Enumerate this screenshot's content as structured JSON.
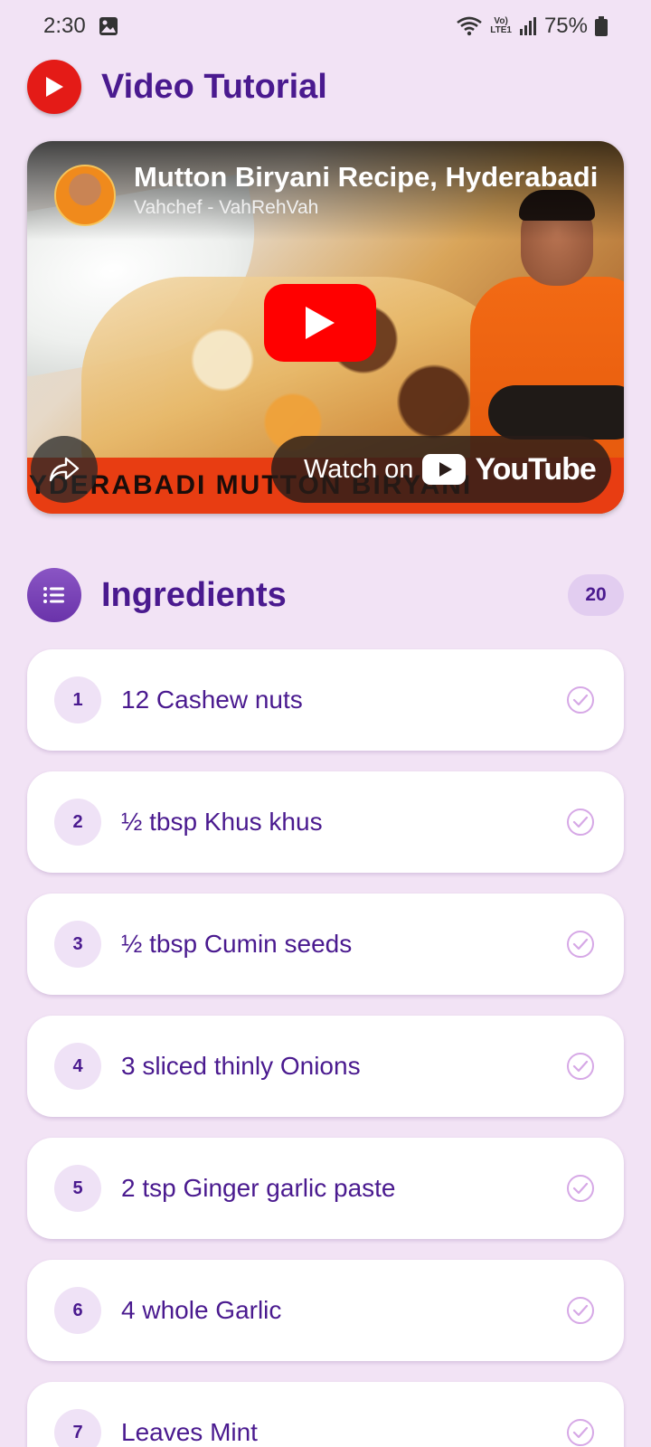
{
  "status_bar": {
    "time": "2:30",
    "battery": "75%",
    "network_label_top": "Vo)",
    "network_label_bottom": "LTE1"
  },
  "header": {
    "title": "Video Tutorial",
    "icon": "youtube-play-icon"
  },
  "video": {
    "title": "Mutton Biryani Recipe, Hyderabadi",
    "channel": "Vahchef - VahRehVah",
    "banner_text": "YDERABADI MUTTON BIRYANI",
    "watch_on": "Watch on",
    "youtube_word": "YouTube",
    "icons": [
      "play-icon",
      "share-icon",
      "youtube-logo-icon"
    ]
  },
  "ingredients": {
    "title": "Ingredients",
    "count": "20",
    "icon": "list-icon",
    "items": [
      {
        "num": "1",
        "text": "12 Cashew nuts"
      },
      {
        "num": "2",
        "text": "½ tbsp Khus khus"
      },
      {
        "num": "3",
        "text": "½ tbsp Cumin seeds"
      },
      {
        "num": "4",
        "text": "3 sliced thinly Onions"
      },
      {
        "num": "5",
        "text": "2 tsp Ginger garlic paste"
      },
      {
        "num": "6",
        "text": "4 whole Garlic"
      },
      {
        "num": "7",
        "text": "Leaves Mint"
      }
    ]
  },
  "colors": {
    "background": "#f2e3f5",
    "accent": "#4a1a8f",
    "youtube_red": "#ff0000",
    "check": "#d6a8e6"
  }
}
